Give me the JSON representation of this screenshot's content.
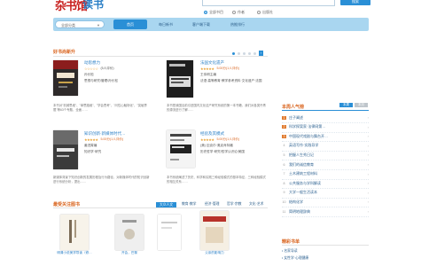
{
  "header": {
    "logo_part1": "杂书馆",
    "logo_part2": "读书",
    "search_button": "搜索",
    "search_placeholder": "",
    "radio_all": "全部书目",
    "radio_author": "作者",
    "radio_press": "出版社"
  },
  "nav": {
    "all_categories": "全部分类",
    "items": [
      "首页",
      "每日新书",
      "客户端下载",
      "热推排行"
    ]
  },
  "sections": {
    "new_books": "好书尚新升",
    "focus": "最受关注图书",
    "hot": "本周人气榜",
    "recommend": "精彩书单"
  },
  "books": [
    {
      "title": "动思想力",
      "rating": "(5人评价)",
      "author": "孙长松",
      "meta": "思想与研究/管理/孙长松",
      "desc": "本书对\"机械思维\"、\"单思路维\"、\"学会思考\"、\"问性心触场化\"、\"突破界限\"等63个专题，全面……"
    },
    {
      "title": "法国文化遗产",
      "rating": "5.00分(1人评价)",
      "author": "王伟明主编",
      "meta": "法语·高等教育·教学参考资料·文化遗产·法国",
      "desc": "本书是我国目前引进国内文化遗产研究系统的第一本书籍，我们对各类丹青的源流进行了解……"
    },
    {
      "title": "知识创新·新媒体时代…",
      "rating": "5.00分(1人评价)",
      "author": "姜进霄编",
      "meta": "知识学·研究",
      "desc": "新媒体背景下知识创新的发展历程及行为路径，对新媒体时代的知识创新进行系统分析，提出……"
    },
    {
      "title": "经验及其模式",
      "rating": "5.00分(1人评价)",
      "author": "(美) 迈克尔·奥克肖特著",
      "meta": "历史哲学·研究/哲学认识论/美国",
      "desc": "本书系统阐述了历史、科学和实践三种经验模式的基本特征，三种经验模式的相互关系……"
    }
  ],
  "rank": {
    "tab_active": "本周",
    "tab_other": "本月",
    "items": [
      "庄子阐述",
      "科学探案家·法律网第…",
      "中国现代戏剧与舞台开…",
      "英语写作·实践导学",
      "把握人生秀日记",
      "我们的诚信教育",
      "土木建筑工程材料",
      "公共服务与学科解读",
      "大学一般生活读本",
      "结构化学",
      "简明地理辞典"
    ]
  },
  "bottom_tabs": [
    "大众人文",
    "教育·教学",
    "经济·管理",
    "哲学·宗教",
    "文化·艺术"
  ],
  "bottom_books": [
    {
      "caption": "明清小说美学导读（修…"
    },
    {
      "caption": "开会，巴黎"
    },
    {
      "caption": ""
    },
    {
      "caption": "父亲的影响力"
    }
  ],
  "recommend_items": [
    "名家导读",
    "女性学·心理健康"
  ]
}
